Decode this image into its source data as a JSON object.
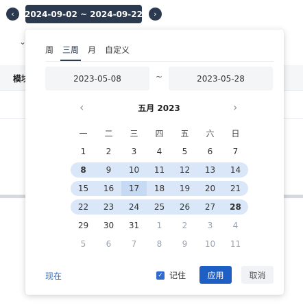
{
  "toolbar": {
    "prev_icon": "chevron-left-icon",
    "next_icon": "chevron-right-icon",
    "range_label": "2024-09-02 ~ 2024-09-22"
  },
  "background": {
    "column_label": "模块"
  },
  "picker": {
    "tabs": [
      {
        "label": "周"
      },
      {
        "label": "三周"
      },
      {
        "label": "月"
      },
      {
        "label": "自定义"
      }
    ],
    "active_tab": "三周",
    "start_date": "2023-05-08",
    "separator": "~",
    "end_date": "2023-05-28",
    "month_title": "五月 2023",
    "weekdays": [
      "一",
      "二",
      "三",
      "四",
      "五",
      "六",
      "日"
    ],
    "weeks": [
      [
        "1",
        "2",
        "3",
        "4",
        "5",
        "6",
        "7"
      ],
      [
        "8",
        "9",
        "10",
        "11",
        "12",
        "13",
        "14"
      ],
      [
        "15",
        "16",
        "17",
        "18",
        "19",
        "20",
        "21"
      ],
      [
        "22",
        "23",
        "24",
        "25",
        "26",
        "27",
        "28"
      ],
      [
        "29",
        "30",
        "31",
        "1",
        "2",
        "3",
        "4"
      ],
      [
        "5",
        "6",
        "7",
        "8",
        "9",
        "10",
        "11"
      ]
    ],
    "now_label": "现在",
    "remember_label": "记住",
    "remember_checked": true,
    "apply_label": "应用",
    "cancel_label": "取消"
  },
  "colors": {
    "toolbar_bg": "#2c3a4f",
    "range_fill": "#d9e7f8",
    "primary": "#1d5fc4",
    "link": "#2e6cc8"
  }
}
